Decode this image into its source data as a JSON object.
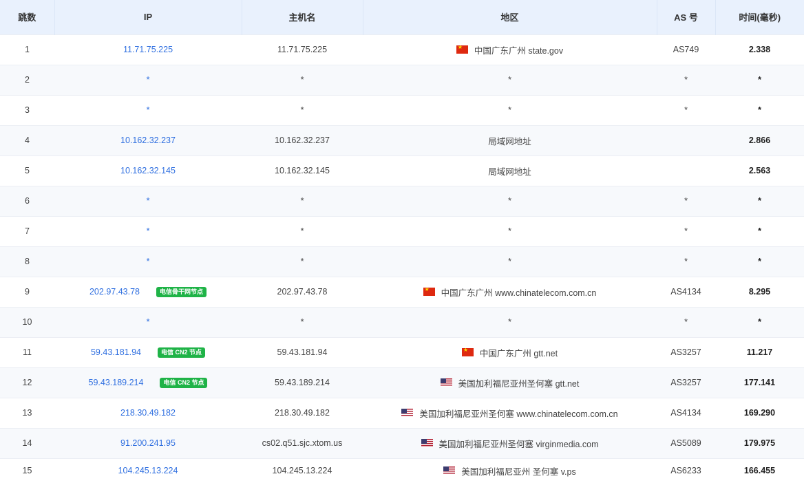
{
  "headers": {
    "hop": "跳数",
    "ip": "IP",
    "host": "主机名",
    "region": "地区",
    "as": "AS 号",
    "time": "时间(毫秒)"
  },
  "rows": [
    {
      "hop": "1",
      "ip": "11.71.75.225",
      "badge": "",
      "host": "11.71.75.225",
      "flag": "cn-flag-icon",
      "region": "中国广东广州 state.gov",
      "as": "AS749",
      "time": "2.338"
    },
    {
      "hop": "2",
      "ip": "*",
      "badge": "",
      "host": "*",
      "flag": "",
      "region": "*",
      "as": "*",
      "time": "*"
    },
    {
      "hop": "3",
      "ip": "*",
      "badge": "",
      "host": "*",
      "flag": "",
      "region": "*",
      "as": "*",
      "time": "*"
    },
    {
      "hop": "4",
      "ip": "10.162.32.237",
      "badge": "",
      "host": "10.162.32.237",
      "flag": "",
      "region": "局域网地址",
      "as": "",
      "time": "2.866"
    },
    {
      "hop": "5",
      "ip": "10.162.32.145",
      "badge": "",
      "host": "10.162.32.145",
      "flag": "",
      "region": "局域网地址",
      "as": "",
      "time": "2.563"
    },
    {
      "hop": "6",
      "ip": "*",
      "badge": "",
      "host": "*",
      "flag": "",
      "region": "*",
      "as": "*",
      "time": "*"
    },
    {
      "hop": "7",
      "ip": "*",
      "badge": "",
      "host": "*",
      "flag": "",
      "region": "*",
      "as": "*",
      "time": "*"
    },
    {
      "hop": "8",
      "ip": "*",
      "badge": "",
      "host": "*",
      "flag": "",
      "region": "*",
      "as": "*",
      "time": "*"
    },
    {
      "hop": "9",
      "ip": "202.97.43.78",
      "badge": "电信骨干网节点",
      "host": "202.97.43.78",
      "flag": "cn-flag-icon",
      "region": "中国广东广州 www.chinatelecom.com.cn",
      "as": "AS4134",
      "time": "8.295"
    },
    {
      "hop": "10",
      "ip": "*",
      "badge": "",
      "host": "*",
      "flag": "",
      "region": "*",
      "as": "*",
      "time": "*"
    },
    {
      "hop": "11",
      "ip": "59.43.181.94",
      "badge": "电信 CN2 节点",
      "host": "59.43.181.94",
      "flag": "cn-flag-icon",
      "region": "中国广东广州 gtt.net",
      "as": "AS3257",
      "time": "11.217"
    },
    {
      "hop": "12",
      "ip": "59.43.189.214",
      "badge": "电信 CN2 节点",
      "host": "59.43.189.214",
      "flag": "us-flag-icon",
      "region": "美国加利福尼亚州圣何塞 gtt.net",
      "as": "AS3257",
      "time": "177.141"
    },
    {
      "hop": "13",
      "ip": "218.30.49.182",
      "badge": "",
      "host": "218.30.49.182",
      "flag": "us-flag-icon",
      "region": "美国加利福尼亚州圣何塞 www.chinatelecom.com.cn",
      "as": "AS4134",
      "time": "169.290"
    },
    {
      "hop": "14",
      "ip": "91.200.241.95",
      "badge": "",
      "host": "cs02.q51.sjc.xtom.us",
      "flag": "us-flag-icon",
      "region": "美国加利福尼亚州圣何塞 virginmedia.com",
      "as": "AS5089",
      "time": "179.975"
    },
    {
      "hop": "15",
      "ip": "104.245.13.224",
      "badge": "",
      "host": "104.245.13.224",
      "flag": "us-flag-icon",
      "region": "美国加利福尼亚州 圣何塞 v.ps",
      "as": "AS6233",
      "time": "166.455"
    }
  ]
}
